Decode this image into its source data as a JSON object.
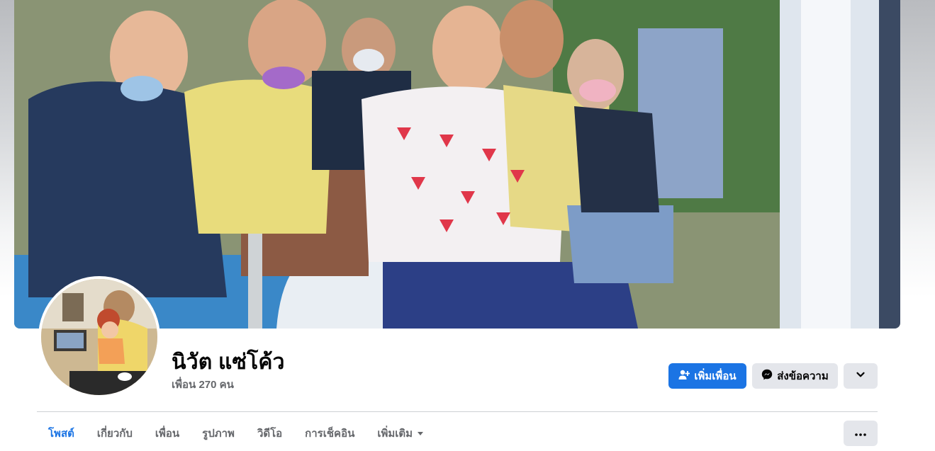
{
  "profile": {
    "name": "นิวัต แซ่โค้ว",
    "friend_count": "เพื่อน 270 คน"
  },
  "actions": {
    "add_friend": "เพิ่มเพื่อน",
    "message": "ส่งข้อความ"
  },
  "tabs": [
    {
      "label": "โพสต์",
      "active": true
    },
    {
      "label": "เกี่ยวกับ",
      "active": false
    },
    {
      "label": "เพื่อน",
      "active": false
    },
    {
      "label": "รูปภาพ",
      "active": false
    },
    {
      "label": "วิดีโอ",
      "active": false
    },
    {
      "label": "การเช็คอิน",
      "active": false
    },
    {
      "label": "เพิ่มเติม",
      "active": false
    }
  ],
  "colors": {
    "accent": "#1b74e4",
    "secondary_button": "#e4e6eb",
    "text_primary": "#050505",
    "text_secondary": "#65676b"
  },
  "icons": {
    "add_friend": "person-plus-icon",
    "message": "messenger-icon",
    "dropdown": "chevron-down-icon",
    "more_tab": "caret-down-icon",
    "more": "ellipsis-icon"
  }
}
